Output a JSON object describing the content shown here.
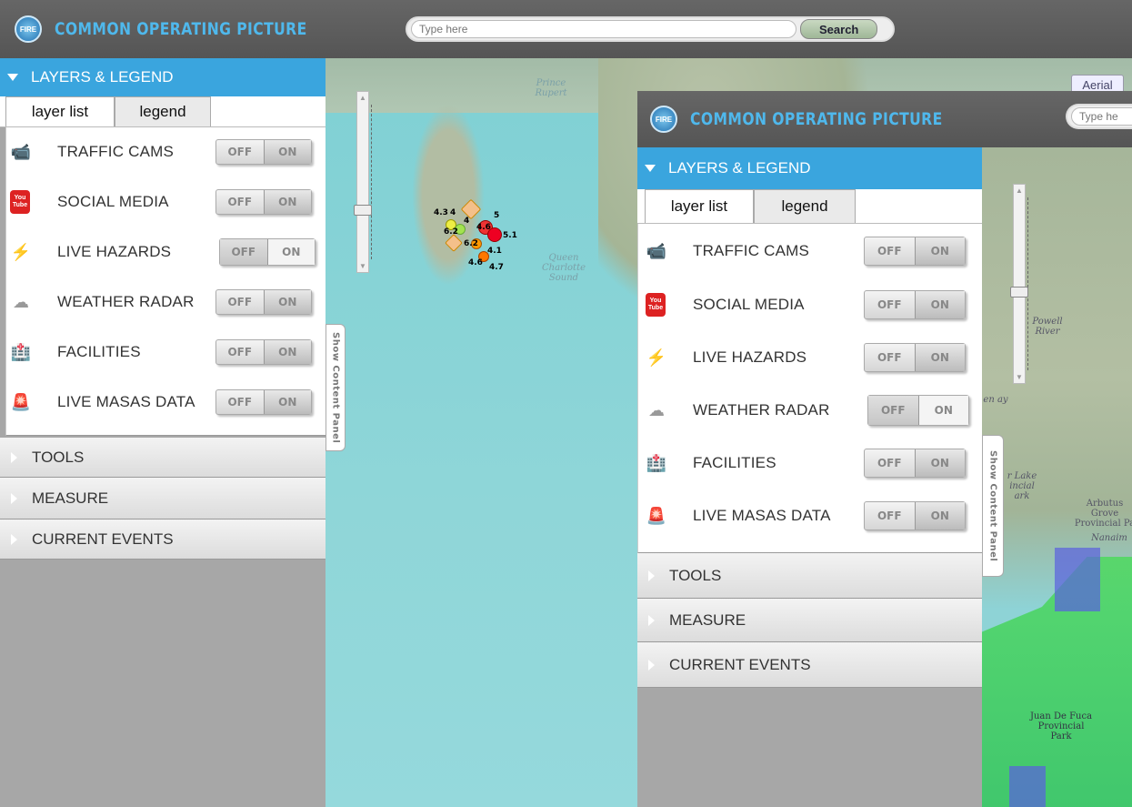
{
  "app": {
    "title": "COMMON OPERATING PICTURE",
    "logo_text": "FIRE"
  },
  "search": {
    "placeholder": "Type here",
    "button_label": "Search"
  },
  "front": {
    "search_placeholder": "Type he"
  },
  "map": {
    "aerial_label": "Aerial",
    "water_color": "#8fd3d6",
    "place_labels": [
      "Prince Rupert",
      "Queen Charlotte Sound",
      "Powell River",
      "Arbutus Grove Provincial Pa",
      "Nanaim",
      "Juan De Fuca Provincial Park",
      "en ay",
      "r Lake incial ark"
    ],
    "markers": [
      "4.3",
      "4",
      "4",
      "5",
      "4.6",
      "6.2",
      "6.2",
      "5.1",
      "4.1",
      "4.6",
      "4.7"
    ]
  },
  "panel": {
    "header": "LAYERS & LEGEND",
    "tabs": [
      "layer list",
      "legend"
    ],
    "layers": [
      {
        "label": "TRAFFIC CAMS",
        "icon": "traffic-cam-icon",
        "off": "OFF",
        "on": "ON"
      },
      {
        "label": "SOCIAL MEDIA",
        "icon": "youtube-icon",
        "off": "OFF",
        "on": "ON"
      },
      {
        "label": "LIVE HAZARDS",
        "icon": "lightning-icon",
        "off": "OFF",
        "on": "ON"
      },
      {
        "label": "WEATHER RADAR",
        "icon": "cloud-icon",
        "off": "OFF",
        "on": "ON"
      },
      {
        "label": "FACILITIES",
        "icon": "hospital-icon",
        "off": "OFF",
        "on": "ON"
      },
      {
        "label": "LIVE MASAS DATA",
        "icon": "siren-icon",
        "off": "OFF",
        "on": "ON"
      }
    ],
    "sections": [
      "TOOLS",
      "MEASURE",
      "CURRENT EVENTS"
    ],
    "side_tab": "Show Content Panel"
  },
  "youtube_icon_text": "You Tube",
  "colors": {
    "accent": "#3aa5de",
    "header_bg": "#5c5c5c",
    "title": "#4fb8ec"
  }
}
